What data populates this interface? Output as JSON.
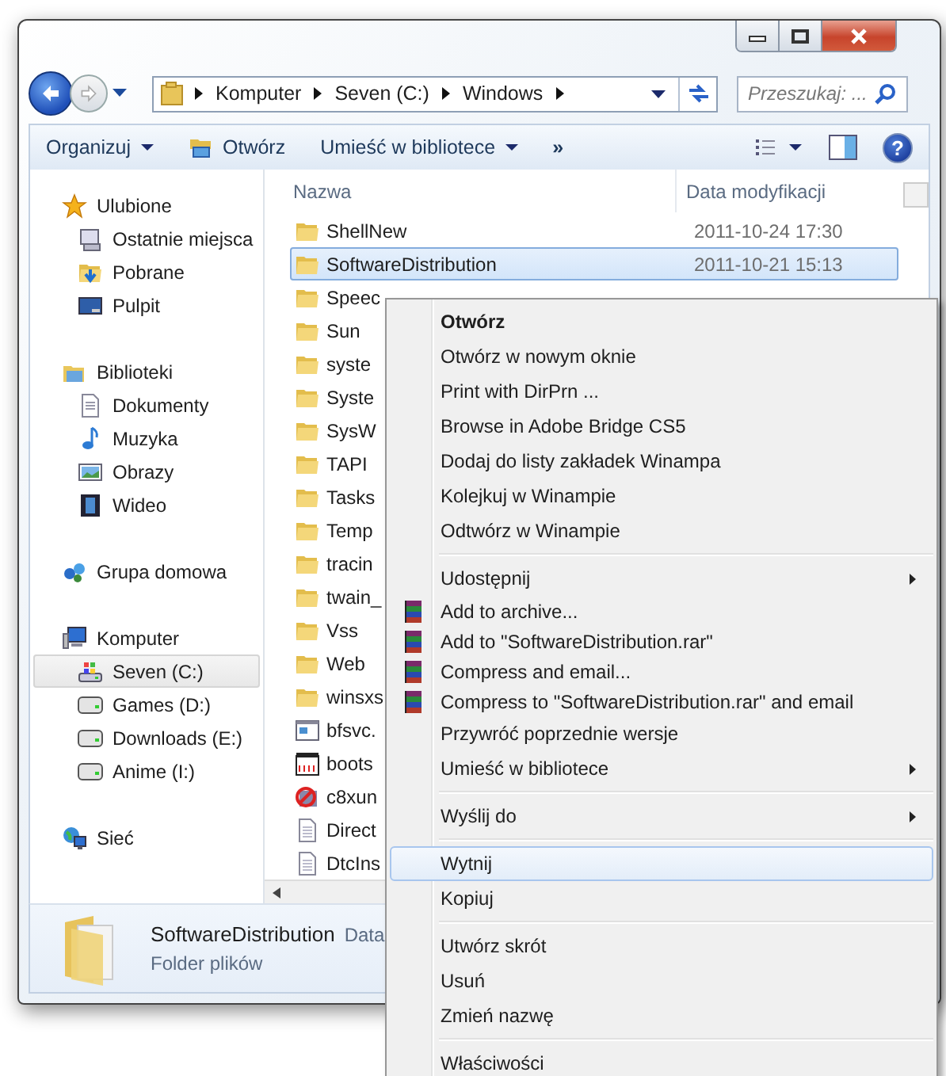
{
  "address_bar": {
    "path": [
      "Komputer",
      "Seven (C:)",
      "Windows"
    ]
  },
  "search": {
    "placeholder": "Przeszukaj: ..."
  },
  "toolbar": [
    {
      "label": "Organizuj",
      "kind": "dropdown"
    },
    {
      "label": "Otwórz",
      "kind": "icon-button"
    },
    {
      "label": "Umieść w bibliotece",
      "kind": "dropdown"
    },
    {
      "label": "»",
      "kind": "overflow"
    }
  ],
  "navigation": [
    {
      "label": "Ulubione",
      "kind": "favorites",
      "children": [
        {
          "label": "Ostatnie miejsca",
          "kind": "recent",
          "selected": false
        },
        {
          "label": "Pobrane",
          "kind": "downloads",
          "selected": false
        },
        {
          "label": "Pulpit",
          "kind": "desktop",
          "selected": false
        }
      ]
    },
    {
      "label": "Biblioteki",
      "kind": "libraries",
      "children": [
        {
          "label": "Dokumenty",
          "kind": "documents",
          "selected": false
        },
        {
          "label": "Muzyka",
          "kind": "music",
          "selected": false
        },
        {
          "label": "Obrazy",
          "kind": "pictures",
          "selected": false
        },
        {
          "label": "Wideo",
          "kind": "video",
          "selected": false
        }
      ]
    },
    {
      "label": "Grupa domowa",
      "kind": "homegroup"
    },
    {
      "label": "Komputer",
      "kind": "computer",
      "children": [
        {
          "label": "Seven (C:)",
          "kind": "system-drive",
          "selected": true
        },
        {
          "label": "Games (D:)",
          "kind": "drive",
          "selected": false
        },
        {
          "label": "Downloads (E:)",
          "kind": "drive",
          "selected": false
        },
        {
          "label": "Anime (I:)",
          "kind": "drive",
          "selected": false
        }
      ]
    },
    {
      "label": "Sieć",
      "kind": "network"
    }
  ],
  "help_button": {
    "label": "?"
  },
  "file_list": {
    "columns": [
      "Nazwa",
      "Data modyfikacji"
    ],
    "rows": [
      {
        "name": "ShellNew",
        "date": "2011-10-24 17:30",
        "kind": "folder",
        "selected": false
      },
      {
        "name": "SoftwareDistribution",
        "date": "2011-10-21 15:13",
        "kind": "folder",
        "selected": true
      },
      {
        "name": "Speec",
        "kind": "folder",
        "selected": false
      },
      {
        "name": "Sun",
        "kind": "folder",
        "selected": false
      },
      {
        "name": "syste",
        "kind": "folder",
        "selected": false
      },
      {
        "name": "Syste",
        "kind": "folder",
        "selected": false
      },
      {
        "name": "SysW",
        "kind": "folder",
        "selected": false
      },
      {
        "name": "TAPI",
        "kind": "folder",
        "selected": false
      },
      {
        "name": "Tasks",
        "kind": "folder",
        "selected": false
      },
      {
        "name": "Temp",
        "kind": "folder",
        "selected": false
      },
      {
        "name": "tracin",
        "kind": "folder",
        "selected": false
      },
      {
        "name": "twain_",
        "kind": "folder",
        "selected": false
      },
      {
        "name": "Vss",
        "kind": "folder",
        "selected": false
      },
      {
        "name": "Web",
        "kind": "folder",
        "selected": false
      },
      {
        "name": "winsxs",
        "kind": "folder",
        "selected": false
      },
      {
        "name": "bfsvc.",
        "kind": "program",
        "selected": false
      },
      {
        "name": "boots",
        "kind": "data",
        "selected": false
      },
      {
        "name": "c8xun",
        "kind": "blocked",
        "selected": false
      },
      {
        "name": "Direct",
        "kind": "text",
        "selected": false
      },
      {
        "name": "DtcIns",
        "kind": "text",
        "selected": false
      }
    ]
  },
  "status_bar": {
    "name": "SoftwareDistribution",
    "detail_label": "Data",
    "type": "Folder plików"
  },
  "context_menu": [
    {
      "kind": "command",
      "label": "Otwórz",
      "default": true,
      "submenu": false,
      "selected": false
    },
    {
      "kind": "command",
      "label": "Otwórz w nowym oknie",
      "default": false,
      "submenu": false,
      "selected": false
    },
    {
      "kind": "command",
      "label": "Print with DirPrn ...",
      "default": false,
      "submenu": false,
      "selected": false
    },
    {
      "kind": "command",
      "label": "Browse in Adobe Bridge CS5",
      "default": false,
      "submenu": false,
      "selected": false
    },
    {
      "kind": "command",
      "label": "Dodaj do listy zakładek Winampa",
      "default": false,
      "submenu": false,
      "selected": false
    },
    {
      "kind": "command",
      "label": "Kolejkuj w Winampie",
      "default": false,
      "submenu": false,
      "selected": false
    },
    {
      "kind": "command",
      "label": "Odtwórz w Winampie",
      "default": false,
      "submenu": false,
      "selected": false
    },
    {
      "kind": "separator"
    },
    {
      "kind": "command",
      "label": "Udostępnij",
      "default": false,
      "submenu": true,
      "selected": false
    },
    {
      "kind": "archive",
      "label": "Add to archive...",
      "default": false,
      "submenu": false,
      "selected": false
    },
    {
      "kind": "archive",
      "label": "Add to \"SoftwareDistribution.rar\"",
      "default": false,
      "submenu": false,
      "selected": false
    },
    {
      "kind": "archive",
      "label": "Compress and email...",
      "default": false,
      "submenu": false,
      "selected": false
    },
    {
      "kind": "archive",
      "label": "Compress to \"SoftwareDistribution.rar\" and email",
      "default": false,
      "submenu": false,
      "selected": false
    },
    {
      "kind": "command",
      "label": "Przywróć poprzednie wersje",
      "default": false,
      "submenu": false,
      "selected": false
    },
    {
      "kind": "command",
      "label": "Umieść w bibliotece",
      "default": false,
      "submenu": true,
      "selected": false
    },
    {
      "kind": "separator"
    },
    {
      "kind": "command",
      "label": "Wyślij do",
      "default": false,
      "submenu": true,
      "selected": false
    },
    {
      "kind": "separator"
    },
    {
      "kind": "command",
      "label": "Wytnij",
      "default": false,
      "submenu": false,
      "selected": true
    },
    {
      "kind": "command",
      "label": "Kopiuj",
      "default": false,
      "submenu": false,
      "selected": false
    },
    {
      "kind": "separator"
    },
    {
      "kind": "command",
      "label": "Utwórz skrót",
      "default": false,
      "submenu": false,
      "selected": false
    },
    {
      "kind": "command",
      "label": "Usuń",
      "default": false,
      "submenu": false,
      "selected": false
    },
    {
      "kind": "command",
      "label": "Zmień nazwę",
      "default": false,
      "submenu": false,
      "selected": false
    },
    {
      "kind": "separator"
    },
    {
      "kind": "command",
      "label": "Właściwości",
      "default": false,
      "submenu": false,
      "selected": false
    }
  ]
}
